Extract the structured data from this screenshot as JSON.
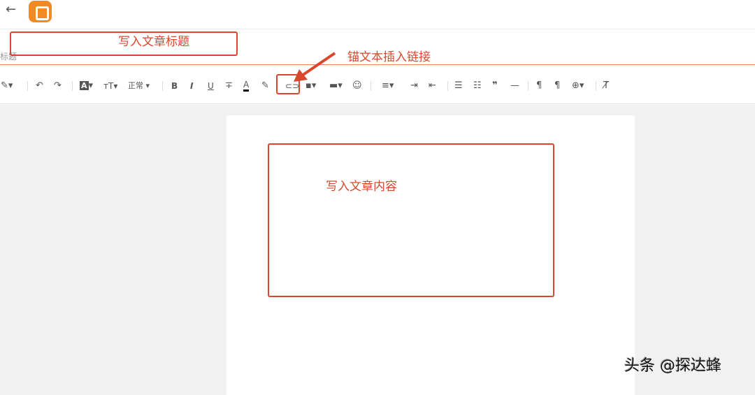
{
  "header": {
    "back_icon": "←",
    "logo": "blogger-logo"
  },
  "title": {
    "placeholder": "标题"
  },
  "toolbar": {
    "font_style": "正常",
    "bold": "B",
    "italic": "I",
    "underline": "U",
    "text_color": "A",
    "text_bg": "A",
    "font_size": "тT"
  },
  "annotations": {
    "title_hint": "写入文章标题",
    "link_hint": "锚文本插入链接",
    "content_hint": "写入文章内容",
    "color": "#d9482c"
  },
  "watermark": "头条 @探达蜂"
}
